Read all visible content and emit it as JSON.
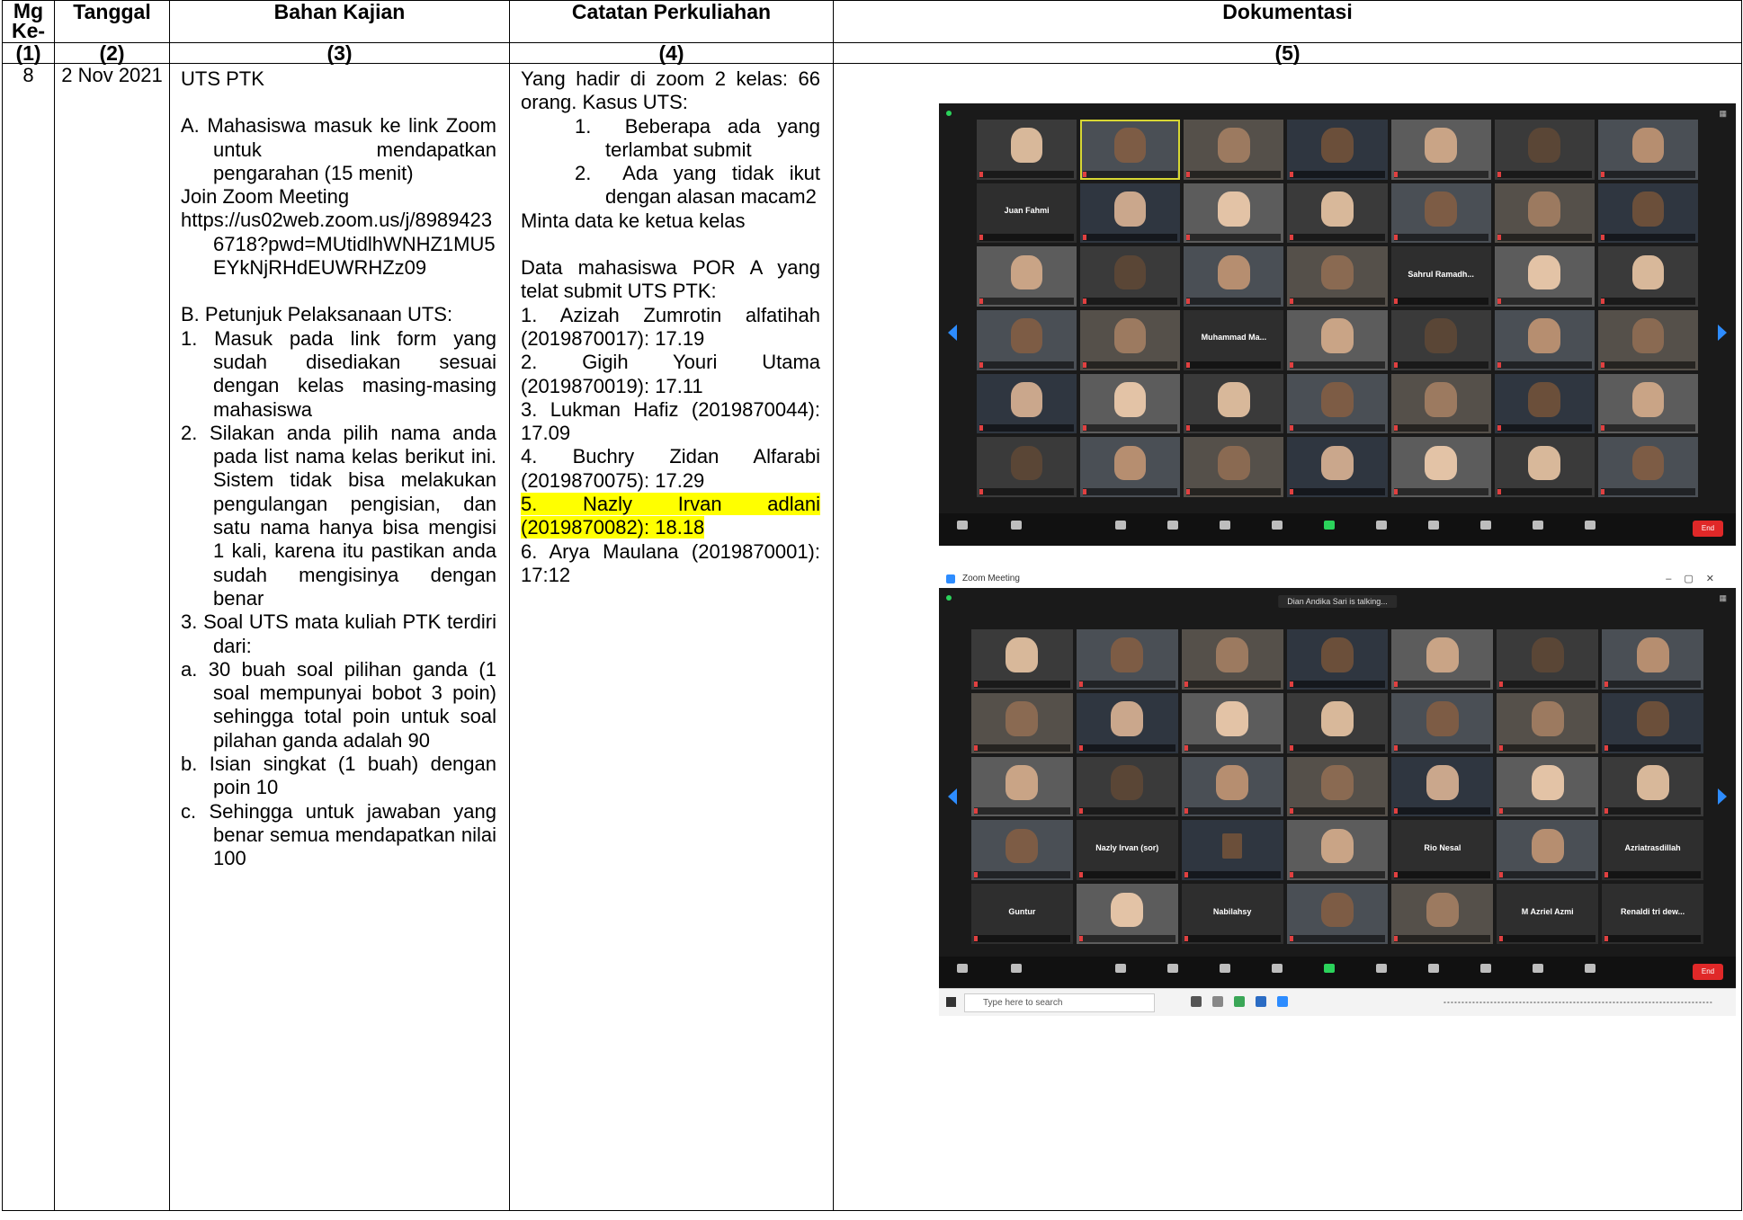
{
  "headers": {
    "col1": "Mg Ke-",
    "col2": "Tanggal",
    "col3": "Bahan Kajian",
    "col4": "Catatan Perkuliahan",
    "col5": "Dokumentasi"
  },
  "numbers": [
    "(1)",
    "(2)",
    "(3)",
    "(4)",
    "(5)"
  ],
  "row": {
    "meeting": "8",
    "date": "2 Nov 2021",
    "bahan": {
      "title": "UTS PTK",
      "a": "A. Mahasiswa masuk ke link Zoom untuk mendapatkan pengarahan (15 menit)",
      "join": "Join Zoom Meeting",
      "link": "https://us02web.zoom.us/j/89894236718?pwd=MUtidlhWNHZ1MU5EYkNjRHdEUWRHZz09",
      "b": "B. Petunjuk Pelaksanaan UTS:",
      "b1": "1. Masuk pada link form yang sudah disediakan sesuai dengan kelas masing-masing mahasiswa",
      "b2": "2. Silakan anda pilih nama anda pada list nama kelas berikut ini. Sistem tidak bisa melakukan pengulangan pengisian, dan satu nama hanya bisa mengisi 1 kali, karena itu pastikan anda sudah mengisinya dengan benar",
      "b3": "3. Soal UTS mata kuliah PTK terdiri dari:",
      "b3a": "a. 30 buah soal pilihan ganda (1 soal mempunyai bobot 3 poin) sehingga total poin untuk soal pilahan ganda adalah 90",
      "b3b": "b. Isian singkat (1 buah) dengan poin 10",
      "b3c": "c. Sehingga untuk jawaban yang benar semua mendapatkan nilai 100"
    },
    "catatan": {
      "intro": "Yang hadir di zoom 2 kelas: 66 orang. Kasus UTS:",
      "k1": "1.  Beberapa ada yang terlambat submit",
      "k2": "2.  Ada yang tidak ikut dengan alasan macam2",
      "minta": "Minta data ke ketua kelas",
      "data_title": "Data mahasiswa POR A yang telat submit UTS PTK:",
      "items": [
        "1. Azizah Zumrotin alfatihah (2019870017): 17.19",
        "2. Gigih Youri Utama (2019870019): 17.11",
        "3. Lukman Hafiz (2019870044): 17.09",
        "4. Buchry Zidan Alfarabi (2019870075): 17.29",
        "5. Nazly Irvan adlani (2019870082): 18.18",
        "6. Arya Maulana (2019870001): 17:12"
      ]
    }
  },
  "screens": {
    "s1": {
      "tiles": [
        "",
        "",
        "",
        "",
        "",
        "",
        "",
        "Juan Fahmi",
        "",
        "",
        "",
        "",
        "",
        "",
        "",
        "",
        "",
        "",
        "Sahrul Ramadh...",
        "",
        "",
        "",
        "",
        "Muhammad Ma...",
        "",
        "",
        "",
        "",
        "",
        "",
        "",
        "",
        "",
        "",
        "",
        "",
        "",
        "",
        "",
        "",
        "",
        ""
      ],
      "end": "End"
    },
    "s2": {
      "window_title": "Zoom Meeting",
      "talking": "Dian Andika Sari is talking...",
      "tiles": [
        "",
        "",
        "",
        "",
        "",
        "",
        "",
        "",
        "",
        "",
        "",
        "",
        "",
        "",
        "",
        "",
        "",
        "",
        "",
        "",
        "",
        "",
        "Nazly Irvan (sor)",
        "",
        "",
        "Rio Nesal",
        "",
        "Azriatrasdillah",
        "Guntur",
        "",
        "Nabilahsy",
        "",
        "",
        "M Azriel Azmi",
        "Renaldi tri dew..."
      ],
      "end": "End",
      "search": "Type here to search"
    }
  },
  "colors": {
    "highlight": "#ffff00",
    "zoom_blue": "#2d8cff",
    "end_red": "#e02828"
  }
}
